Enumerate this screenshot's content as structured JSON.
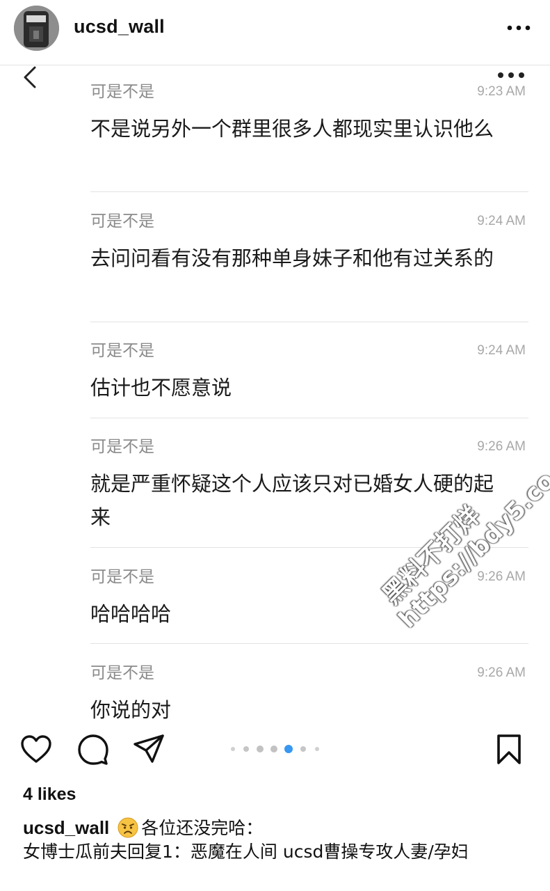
{
  "header": {
    "account_name": "ucsd_wall"
  },
  "messages": [
    {
      "sender": "可是不是",
      "time": "9:23 AM",
      "text": "不是说另外一个群里很多人都现实里认识他么"
    },
    {
      "sender": "可是不是",
      "time": "9:24 AM",
      "text": "去问问看有没有那种单身妹子和他有过关系的"
    },
    {
      "sender": "可是不是",
      "time": "9:24 AM",
      "text": "估计也不愿意说"
    },
    {
      "sender": "可是不是",
      "time": "9:26 AM",
      "text": "就是严重怀疑这个人应该只对已婚女人硬的起来"
    },
    {
      "sender": "可是不是",
      "time": "9:26 AM",
      "text": "哈哈哈哈"
    },
    {
      "sender": "可是不是",
      "time": "9:26 AM",
      "text": "你说的对"
    }
  ],
  "watermark": {
    "line1": "黑料不打烊",
    "line2": "https://bdy5.co"
  },
  "actions": {
    "icons": [
      "heart-icon",
      "comment-icon",
      "share-icon",
      "bookmark-icon"
    ],
    "carousel_active_index": 3,
    "carousel_count": 7
  },
  "post": {
    "likes": "4 likes",
    "caption_user": "ucsd_wall",
    "caption_line1": "各位还没完哈：",
    "caption_line2": "女博士瓜前夫回复1：恶魔在人间 ucsd曹操专攻人妻/孕妇"
  },
  "colors": {
    "accent_blue": "#3897f0",
    "timestamp_gray": "#a8a8a8",
    "sender_gray": "#8a8a8a"
  }
}
